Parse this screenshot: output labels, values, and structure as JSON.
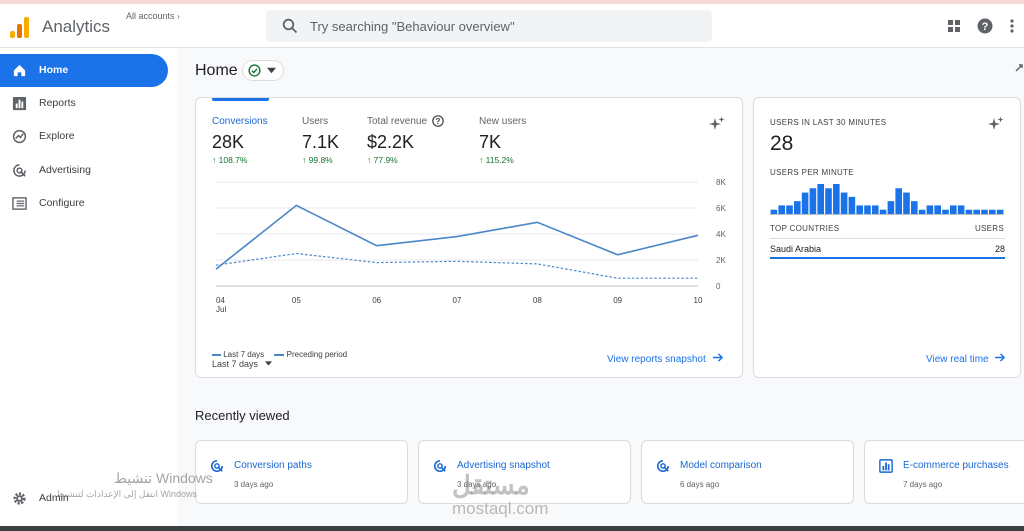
{
  "header": {
    "app_title": "Analytics",
    "accounts_label": "All accounts",
    "search_placeholder": "Try searching \"Behaviour overview\""
  },
  "sidebar": {
    "items": [
      {
        "label": "Home",
        "icon": "home-icon"
      },
      {
        "label": "Reports",
        "icon": "bar-chart-icon"
      },
      {
        "label": "Explore",
        "icon": "explore-icon"
      },
      {
        "label": "Advertising",
        "icon": "advertising-icon"
      },
      {
        "label": "Configure",
        "icon": "list-icon"
      }
    ],
    "admin_label": "Admin"
  },
  "page": {
    "title": "Home"
  },
  "metrics": [
    {
      "label": "Conversions",
      "value": "28K",
      "change": "108.7%"
    },
    {
      "label": "Users",
      "value": "7.1K",
      "change": "99.8%"
    },
    {
      "label": "Total revenue",
      "value": "$2.2K",
      "change": "77.9%"
    },
    {
      "label": "New users",
      "value": "7K",
      "change": "115.2%"
    }
  ],
  "chart_data": {
    "type": "line",
    "x": [
      "04 Jul",
      "05",
      "06",
      "07",
      "08",
      "09",
      "10"
    ],
    "x_ticks": [
      "04",
      "05",
      "06",
      "07",
      "08",
      "09",
      "10"
    ],
    "x_month": "Jul",
    "y_ticks": [
      "8K",
      "6K",
      "4K",
      "2K",
      "0"
    ],
    "ylim": [
      0,
      8000
    ],
    "series": [
      {
        "name": "Last 7 days",
        "values": [
          1300,
          6200,
          3100,
          3800,
          4900,
          2400,
          3900
        ],
        "style": "solid",
        "color": "#4a86c8"
      },
      {
        "name": "Preceding period",
        "values": [
          1600,
          2500,
          1800,
          1900,
          1700,
          600,
          600
        ],
        "style": "dashed",
        "color": "#4a86c8"
      }
    ],
    "legend": "bottom-left",
    "grid": true
  },
  "main_card": {
    "date_range": "Last 7 days",
    "link_label": "View reports snapshot"
  },
  "realtime": {
    "title": "USERS IN LAST 30 MINUTES",
    "value": "28",
    "per_minute_label": "USERS PER MINUTE",
    "per_minute_bars": [
      1,
      2,
      2,
      3,
      5,
      6,
      7,
      6,
      7,
      5,
      4,
      2,
      2,
      2,
      1,
      3,
      6,
      5,
      3,
      1,
      2,
      2,
      1,
      2,
      2,
      1,
      1,
      1,
      1,
      1
    ],
    "countries_header": "TOP COUNTRIES",
    "users_header": "USERS",
    "countries": [
      {
        "name": "Saudi Arabia",
        "users": "28"
      }
    ],
    "link_label": "View real time"
  },
  "recent": {
    "title": "Recently viewed",
    "items": [
      {
        "name": "Conversion paths",
        "time": "3 days ago",
        "icon": "explore-icon"
      },
      {
        "name": "Advertising snapshot",
        "time": "3 days ago",
        "icon": "advertising-icon"
      },
      {
        "name": "Model comparison",
        "time": "6 days ago",
        "icon": "advertising-icon"
      },
      {
        "name": "E-commerce purchases",
        "time": "7 days ago",
        "icon": "bar-chart-icon"
      }
    ]
  },
  "watermarks": {
    "windows_title": "تنشيط Windows",
    "windows_sub": "انتقل إلى الإعدادات لتنشيط Windows",
    "site_arabic": "مستقل",
    "site_url": "mostaql.com"
  }
}
